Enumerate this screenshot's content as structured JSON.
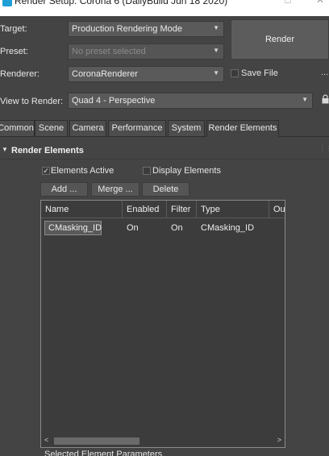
{
  "window": {
    "title": "Render Setup: Corona 6 (DailyBuild Jun 18 2020)"
  },
  "fields": {
    "target_label": "Target:",
    "target_value": "Production Rendering Mode",
    "preset_label": "Preset:",
    "preset_value": "No preset selected",
    "renderer_label": "Renderer:",
    "renderer_value": "CoronaRenderer",
    "view_label": "View to Render:",
    "view_value": "Quad 4 - Perspective"
  },
  "render_button": "Render",
  "save_file": {
    "label": "Save File",
    "checked": false
  },
  "more_button": "...",
  "tabs": [
    {
      "label": "Common"
    },
    {
      "label": "Scene"
    },
    {
      "label": "Camera"
    },
    {
      "label": "Performance"
    },
    {
      "label": "System"
    },
    {
      "label": "Render Elements",
      "active": true
    }
  ],
  "rollout": {
    "title": "Render Elements",
    "elements_active": {
      "label": "Elements Active",
      "checked": true
    },
    "display_elements": {
      "label": "Display Elements",
      "checked": false
    },
    "buttons": {
      "add": "Add ...",
      "merge": "Merge ...",
      "delete": "Delete"
    }
  },
  "table": {
    "columns": [
      "Name",
      "Enabled",
      "Filter",
      "Type",
      "Ou"
    ],
    "rows": [
      {
        "name": "CMasking_ID",
        "enabled": "On",
        "filter": "On",
        "type": "CMasking_ID"
      }
    ]
  },
  "footer_label": "Selected Element Parameters",
  "colors": {
    "panel": "#444444",
    "field": "#5a5a5a",
    "list_bg": "#3c3c3c"
  }
}
